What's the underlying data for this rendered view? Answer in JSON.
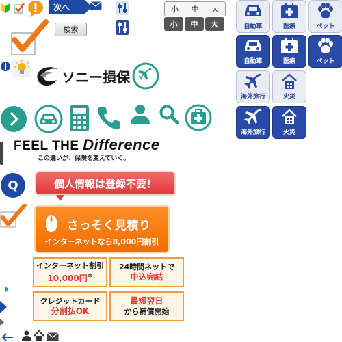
{
  "sprites": {
    "next_label": "次へ",
    "search_label": "検索"
  },
  "font_size": {
    "light": [
      "小",
      "中",
      "大"
    ],
    "dark": [
      "小",
      "中",
      "大"
    ]
  },
  "categories": {
    "auto": "自動車",
    "medical": "医療",
    "pet": "ペット",
    "travel": "海外旅行",
    "fire": "火災"
  },
  "logo": {
    "name": "ソニー損保"
  },
  "tagline": {
    "feel": "FEEL THE ",
    "difference": "Difference",
    "sub": "この違いが、保険を変えていく。"
  },
  "faq": {
    "q": "Q"
  },
  "bubble_text": "個人情報は登録不要！",
  "cta": {
    "title": "さっそく見積り",
    "sub": "インターネットなら8,000円割引"
  },
  "features": [
    {
      "line1": "インターネット割引",
      "line2": "10,000円",
      "mark": "※"
    },
    {
      "line1": "24時間ネットで",
      "line2": "申込完結"
    },
    {
      "line1": "クレジットカード",
      "line2": "分割払OK"
    },
    {
      "line1": "最短翌日",
      "line2": "から補償開始"
    }
  ],
  "colors": {
    "teal": "#2a9d8f",
    "navy": "#1f4aa3",
    "orange": "#f07a10",
    "red": "#e2393a"
  }
}
